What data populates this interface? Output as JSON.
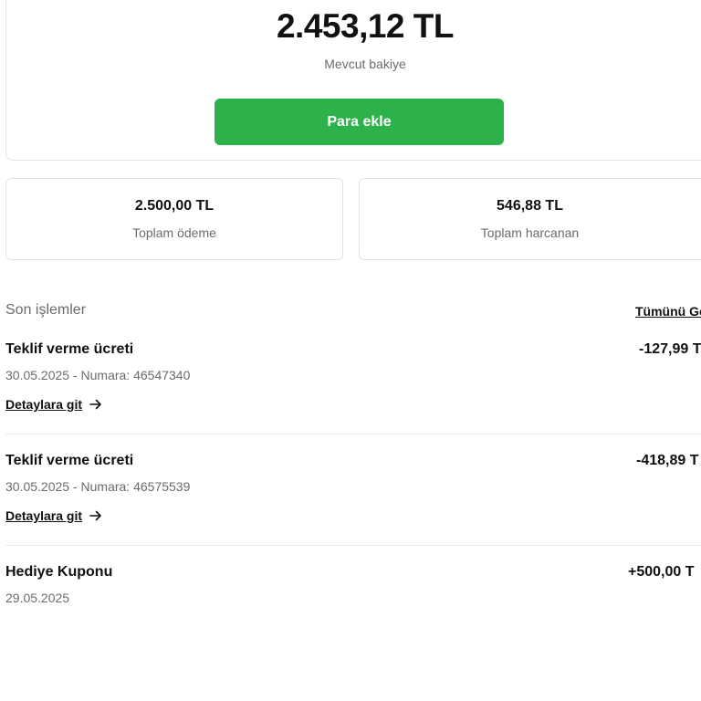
{
  "balance": {
    "amount": "2.453,12 TL",
    "label": "Mevcut bakiye",
    "add_button_label": "Para ekle"
  },
  "stats": [
    {
      "value": "2.500,00 TL",
      "label": "Toplam ödeme"
    },
    {
      "value": "546,88 TL",
      "label": "Toplam harcanan"
    }
  ],
  "recent": {
    "title": "Son işlemler",
    "view_all_label": "Tümünü Gö"
  },
  "transactions": [
    {
      "title": "Teklif verme ücreti",
      "meta": "30.05.2025 - Numara: 46547340",
      "amount": "-127,99 T",
      "link_label": "Detaylara git"
    },
    {
      "title": "Teklif verme ücreti",
      "meta": "30.05.2025 - Numara: 46575539",
      "amount": "-418,89 T",
      "link_label": "Detaylara git"
    },
    {
      "title": "Hediye Kuponu",
      "meta": "29.05.2025",
      "amount": "+500,00 T"
    }
  ],
  "icons": {
    "link_arrow": "arrow-right-icon"
  },
  "colors": {
    "accent_green": "#2db24b",
    "muted_text": "#6b6b6b",
    "border": "#e3e3e3"
  }
}
